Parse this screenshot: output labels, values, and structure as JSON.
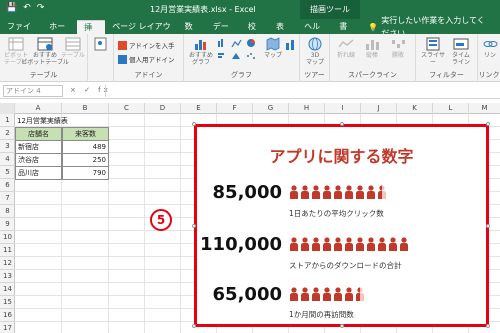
{
  "titlebar": {
    "qat_icons": [
      "save-icon",
      "undo-icon",
      "redo-icon"
    ],
    "doc_title": "12月営業実績表.xlsx  -  Excel",
    "tool_tab": "描画ツール"
  },
  "ribbon_tabs": [
    "ファイル",
    "ホーム",
    "挿入",
    "ページ レイアウト",
    "数式",
    "データ",
    "校閲",
    "表示",
    "ヘルプ",
    "書式"
  ],
  "active_tab": "挿入",
  "tell_me": "実行したい作業を入力してください",
  "ribbon": {
    "groups": [
      {
        "name": "テーブル",
        "buttons": [
          "ピボット\nテーブル",
          "おすすめ\nピボットテーブル",
          "テーブル"
        ]
      },
      {
        "name": "アドイン",
        "buttons": [
          "アドインを入手",
          "個人用アドイン"
        ]
      },
      {
        "name": "グラフ",
        "buttons": [
          "おすすめ\nグラフ",
          "マップ",
          "ピボットグラフ"
        ]
      },
      {
        "name": "ツアー",
        "buttons": [
          "3D\nマップ"
        ]
      },
      {
        "name": "スパークライン",
        "buttons": [
          "折れ線",
          "縦棒",
          "勝敗"
        ]
      },
      {
        "name": "フィルター",
        "buttons": [
          "スライサー",
          "タイム\nライン"
        ]
      },
      {
        "name": "リンク",
        "buttons": [
          "リン"
        ]
      }
    ]
  },
  "formula_bar": {
    "name_box": "アドイン 4",
    "fx": "× ✓ fx",
    "value": ""
  },
  "columns": [
    "A",
    "B",
    "C",
    "D",
    "E",
    "F",
    "G",
    "H",
    "I",
    "J",
    "K",
    "L",
    "M"
  ],
  "rows": [
    "1",
    "2",
    "3",
    "4",
    "5",
    "6",
    "7",
    "8",
    "9",
    "10",
    "11",
    "12",
    "13",
    "14",
    "15",
    "16",
    "17"
  ],
  "sheet": {
    "a1": "12月営業実績表",
    "headers": [
      "店舗名",
      "来客数"
    ],
    "data": [
      {
        "store": "新宿店",
        "visitors": "489"
      },
      {
        "store": "渋谷店",
        "visitors": "250"
      },
      {
        "store": "品川店",
        "visitors": "790"
      }
    ]
  },
  "step_badge": "5",
  "infographic": {
    "title": "アプリに関する数字",
    "color": "#c0392b",
    "stats": [
      {
        "value": "85,000",
        "caption": "1日あたりの平均クリック数",
        "icons": 8.5
      },
      {
        "value": "110,000",
        "caption": "ストアからのダウンロードの合計",
        "icons": 11
      },
      {
        "value": "65,000",
        "caption": "1か月間の再訪問数",
        "icons": 6.5
      }
    ]
  },
  "colors": {
    "excel_green": "#217346",
    "accent_red": "#e60012",
    "header_fill": "#c6e0b4"
  }
}
